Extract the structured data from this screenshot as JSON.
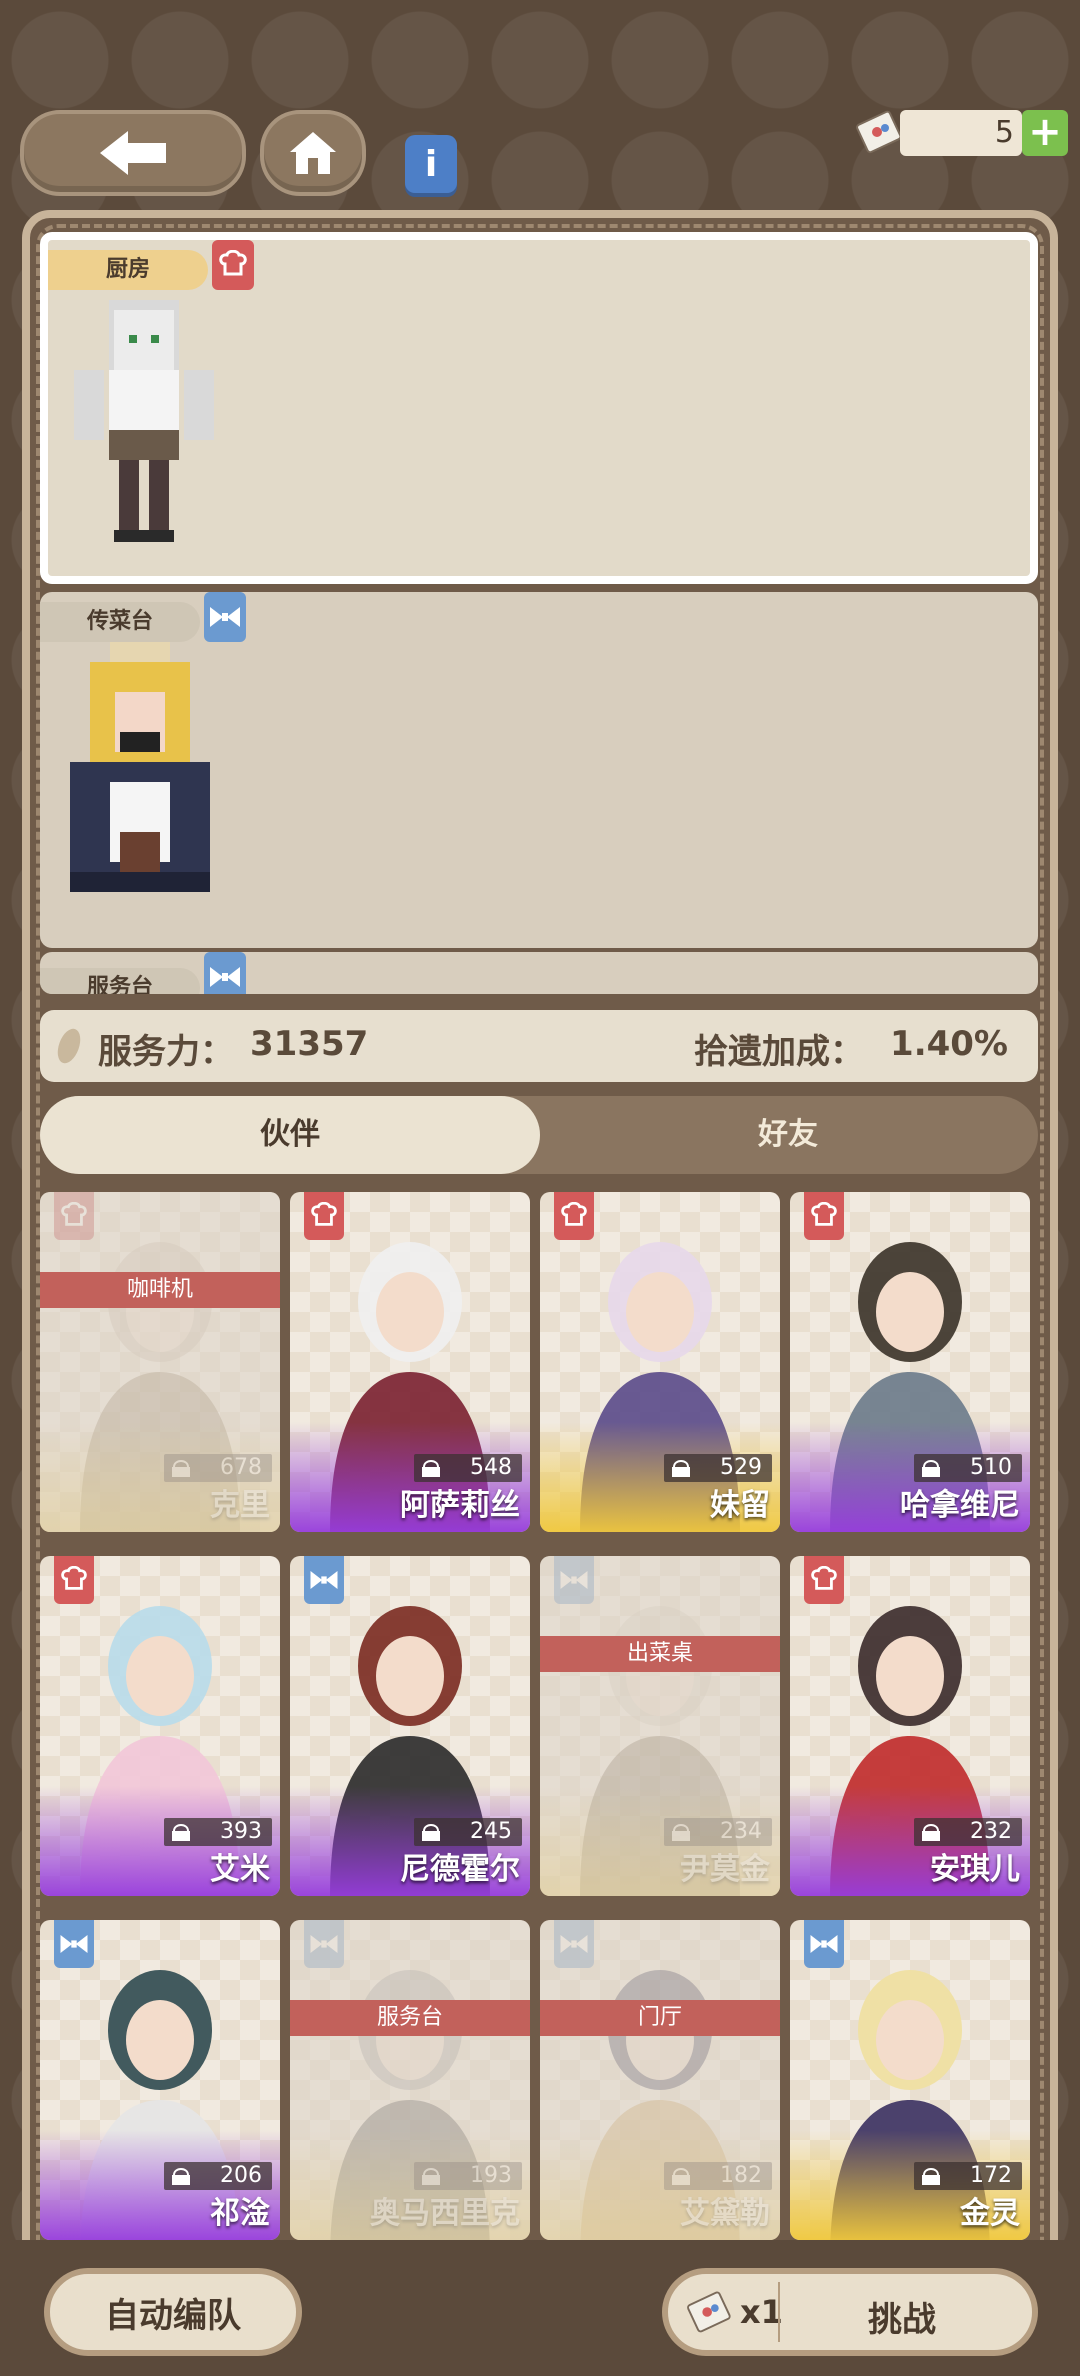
{
  "header": {
    "back_icon": "back-arrow-icon",
    "home_icon": "home-icon",
    "info_icon": "info-icon",
    "ticket_count": "5",
    "plus_label": "+"
  },
  "slots": [
    {
      "label": "厨房",
      "role_icon": "chef-hat-icon"
    },
    {
      "label": "传菜台",
      "role_icon": "bowtie-icon"
    },
    {
      "label": "服务台",
      "role_icon": "bowtie-icon"
    }
  ],
  "stats": {
    "service_label": "服务力：",
    "service_value": "31357",
    "bonus_label": "拾遗加成：",
    "bonus_value": "1.40%"
  },
  "tabs": [
    {
      "label": "伙伴",
      "active": true
    },
    {
      "label": "好友",
      "active": false
    }
  ],
  "cards": [
    {
      "name": "克里",
      "power": "678",
      "role": "chef",
      "assigned": "咖啡机",
      "rarity": "gold"
    },
    {
      "name": "阿萨莉丝",
      "power": "548",
      "role": "chef",
      "assigned": "",
      "rarity": "purple"
    },
    {
      "name": "妹留",
      "power": "529",
      "role": "chef",
      "assigned": "",
      "rarity": "gold"
    },
    {
      "name": "哈拿维尼",
      "power": "510",
      "role": "chef",
      "assigned": "",
      "rarity": "purple"
    },
    {
      "name": "艾米",
      "power": "393",
      "role": "chef",
      "assigned": "",
      "rarity": "purple"
    },
    {
      "name": "尼德霍尔",
      "power": "245",
      "role": "waiter",
      "assigned": "",
      "rarity": "purple"
    },
    {
      "name": "尹莫金",
      "power": "234",
      "role": "waiter",
      "assigned": "出菜桌",
      "rarity": "gold"
    },
    {
      "name": "安琪儿",
      "power": "232",
      "role": "chef",
      "assigned": "",
      "rarity": "purple"
    },
    {
      "name": "祁淦",
      "power": "206",
      "role": "waiter",
      "assigned": "",
      "rarity": "purple"
    },
    {
      "name": "奥马西里克",
      "power": "193",
      "role": "waiter",
      "assigned": "服务台",
      "rarity": "gold"
    },
    {
      "name": "艾黛勒",
      "power": "182",
      "role": "waiter",
      "assigned": "门厅",
      "rarity": "gold"
    },
    {
      "name": "金灵",
      "power": "172",
      "role": "waiter",
      "assigned": "",
      "rarity": "gold"
    }
  ],
  "footer": {
    "auto_label": "自动编队",
    "ticket_cost": "x1",
    "challenge_label": "挑战"
  }
}
